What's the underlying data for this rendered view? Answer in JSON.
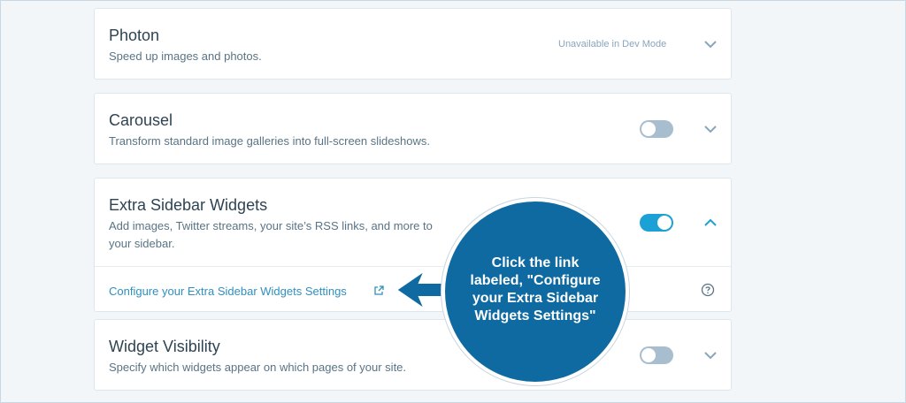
{
  "modules": [
    {
      "title": "Photon",
      "description": "Speed up images and photos.",
      "status_note": "Unavailable in Dev Mode",
      "toggle": null,
      "expanded": false
    },
    {
      "title": "Carousel",
      "description": "Transform standard image galleries into full-screen slideshows.",
      "toggle": "off",
      "expanded": false
    },
    {
      "title": "Extra Sidebar Widgets",
      "description_line1": "Add images, Twitter streams, your site’s RSS links, and more to",
      "description_line2": "your sidebar.",
      "toggle": "on",
      "expanded": true,
      "settings_link": "Configure your Extra Sidebar Widgets Settings"
    },
    {
      "title": "Widget Visibility",
      "description": "Specify which widgets appear on which pages of your site.",
      "toggle": "off",
      "expanded": false
    }
  ],
  "callout": {
    "line1": "Click the link",
    "line2": "labeled, \"Configure",
    "line3": "your Extra Sidebar",
    "line4": "Widgets Settings\""
  },
  "colors": {
    "accent": "#1ba1d6",
    "callout": "#0e6aa0",
    "link": "#2f8fbf"
  },
  "icons": {
    "expand": "chevron-down-icon",
    "collapse": "chevron-up-icon",
    "external": "external-link-icon",
    "help": "help-circle-icon"
  }
}
